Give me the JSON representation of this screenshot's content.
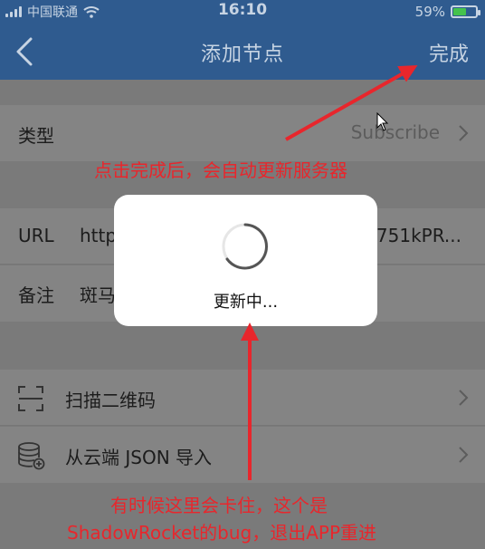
{
  "status_bar": {
    "carrier": "中国联通",
    "time": "16:10",
    "battery_percent": "59%",
    "battery_level": 0.59
  },
  "nav": {
    "title": "添加节点",
    "done_label": "完成",
    "back_icon": "chevron-left-icon"
  },
  "form": {
    "type": {
      "label": "类型",
      "value": "Subscribe"
    },
    "url": {
      "label": "URL",
      "value_start": "http",
      "value_end": "751kPR..."
    },
    "remark": {
      "label": "备注",
      "value": "斑马"
    }
  },
  "actions": [
    {
      "label": "扫描二维码",
      "icon": "qr-scan-icon"
    },
    {
      "label": "从云端 JSON 导入",
      "icon": "database-icon"
    }
  ],
  "loading": {
    "text": "更新中..."
  },
  "annotations": {
    "top": "点击完成后，会自动更新服务器",
    "bottom_line1": "有时候这里会卡住，这个是",
    "bottom_line2": "ShadowRocket的bug，退出APP重进",
    "color": "#e8262c"
  },
  "colors": {
    "nav_bg": "#2f5b8f",
    "overlay_bg": "#7a7a7a",
    "battery": "#45c24d"
  }
}
